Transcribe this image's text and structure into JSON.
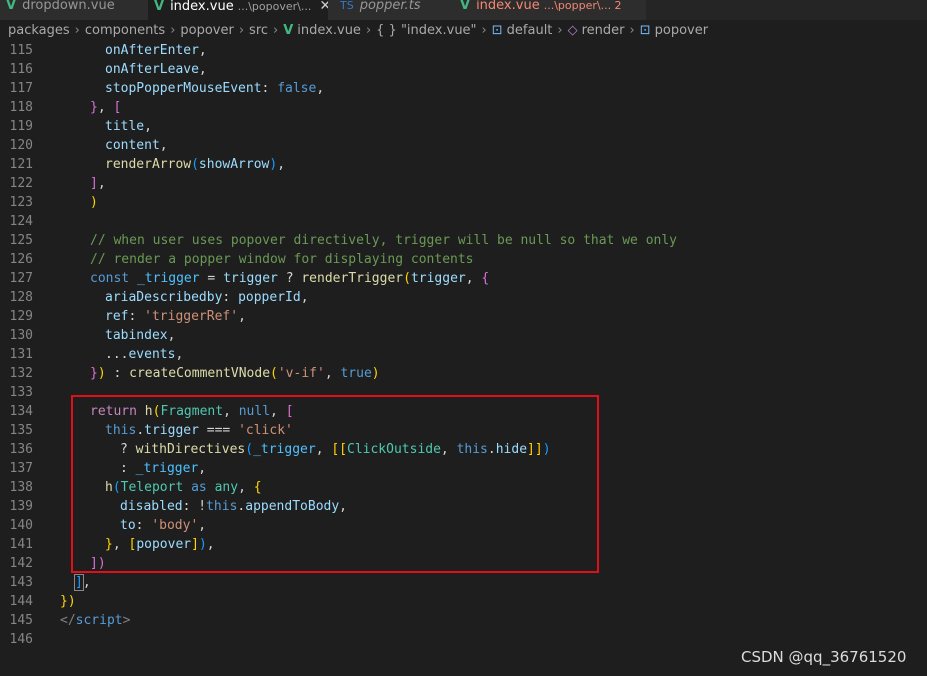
{
  "tabs": [
    {
      "name": "dropdown.vue",
      "desc": "",
      "icon": "vue-icon"
    },
    {
      "name": "index.vue",
      "desc": "...\\popover\\...",
      "icon": "vue-icon",
      "active": true,
      "close": "✕"
    },
    {
      "name": "popper.ts",
      "desc": "",
      "icon": "ts-icon",
      "icon_text": "TS"
    },
    {
      "name": "index.vue",
      "desc": "...\\popper\\... 2",
      "icon": "vue-icon"
    }
  ],
  "breadcrumb": [
    "packages",
    "components",
    "popover",
    "src",
    "index.vue",
    "{ } \"index.vue\"",
    "default",
    "render",
    "popover"
  ],
  "lines": [
    "115",
    "116",
    "117",
    "118",
    "119",
    "120",
    "121",
    "122",
    "123",
    "124",
    "125",
    "126",
    "127",
    "128",
    "129",
    "130",
    "131",
    "132",
    "133",
    "134",
    "135",
    "136",
    "137",
    "138",
    "139",
    "140",
    "141",
    "142",
    "143",
    "144",
    "145",
    "146"
  ],
  "code": {
    "l115": [
      "onAfterEnter",
      ","
    ],
    "l116": [
      "onAfterLeave",
      ","
    ],
    "l117": [
      "stopPopperMouseEvent",
      ":",
      "false",
      ","
    ],
    "l118": [
      "}",
      ",",
      "["
    ],
    "l119": [
      "title",
      ","
    ],
    "l120": [
      "content",
      ","
    ],
    "l121": [
      "renderArrow",
      "(",
      "showArrow",
      ")",
      ","
    ],
    "l122": [
      "]",
      ","
    ],
    "l123": [
      ")"
    ],
    "l125": [
      "// when user uses popover directively, trigger will be null so that we only"
    ],
    "l126": [
      "// render a popper window for displaying contents"
    ],
    "l127": [
      "const",
      "_trigger",
      "=",
      "trigger",
      "?",
      "renderTrigger",
      "(",
      "trigger",
      ",",
      "{"
    ],
    "l128": [
      "ariaDescribedby",
      ":",
      "popperId",
      ","
    ],
    "l129": [
      "ref",
      ":",
      "'triggerRef'",
      ","
    ],
    "l130": [
      "tabindex",
      ","
    ],
    "l131": [
      "...",
      "events",
      ","
    ],
    "l132": [
      "}",
      ")",
      ":",
      "createCommentVNode",
      "(",
      "'v-if'",
      ",",
      "true",
      ")"
    ],
    "l134": [
      "return",
      "h",
      "(",
      "Fragment",
      ",",
      "null",
      ",",
      "["
    ],
    "l135": [
      "this",
      ".",
      "trigger",
      "===",
      "'click'"
    ],
    "l136": [
      "?",
      "withDirectives",
      "(",
      "_trigger",
      ",",
      "[[",
      "ClickOutside",
      ",",
      "this",
      ".",
      "hide",
      "]]",
      ")"
    ],
    "l137": [
      ":",
      "_trigger",
      ","
    ],
    "l138": [
      "h",
      "(",
      "Teleport",
      "as",
      "any",
      ",",
      "{"
    ],
    "l139": [
      "disabled",
      ":",
      "!",
      "this",
      ".",
      "appendToBody",
      ","
    ],
    "l140": [
      "to",
      ":",
      "'body'",
      ","
    ],
    "l141": [
      "}",
      ",",
      "[",
      "popover",
      "]",
      ")",
      ","
    ],
    "l142": [
      "])"
    ],
    "l143": [
      "]",
      ","
    ],
    "l144": [
      "})"
    ],
    "l145": [
      "</",
      "script",
      ">"
    ]
  },
  "watermark": "CSDN @qq_36761520",
  "colors": {
    "highlight_box": "#e0101a",
    "background": "#1e1e1e"
  }
}
